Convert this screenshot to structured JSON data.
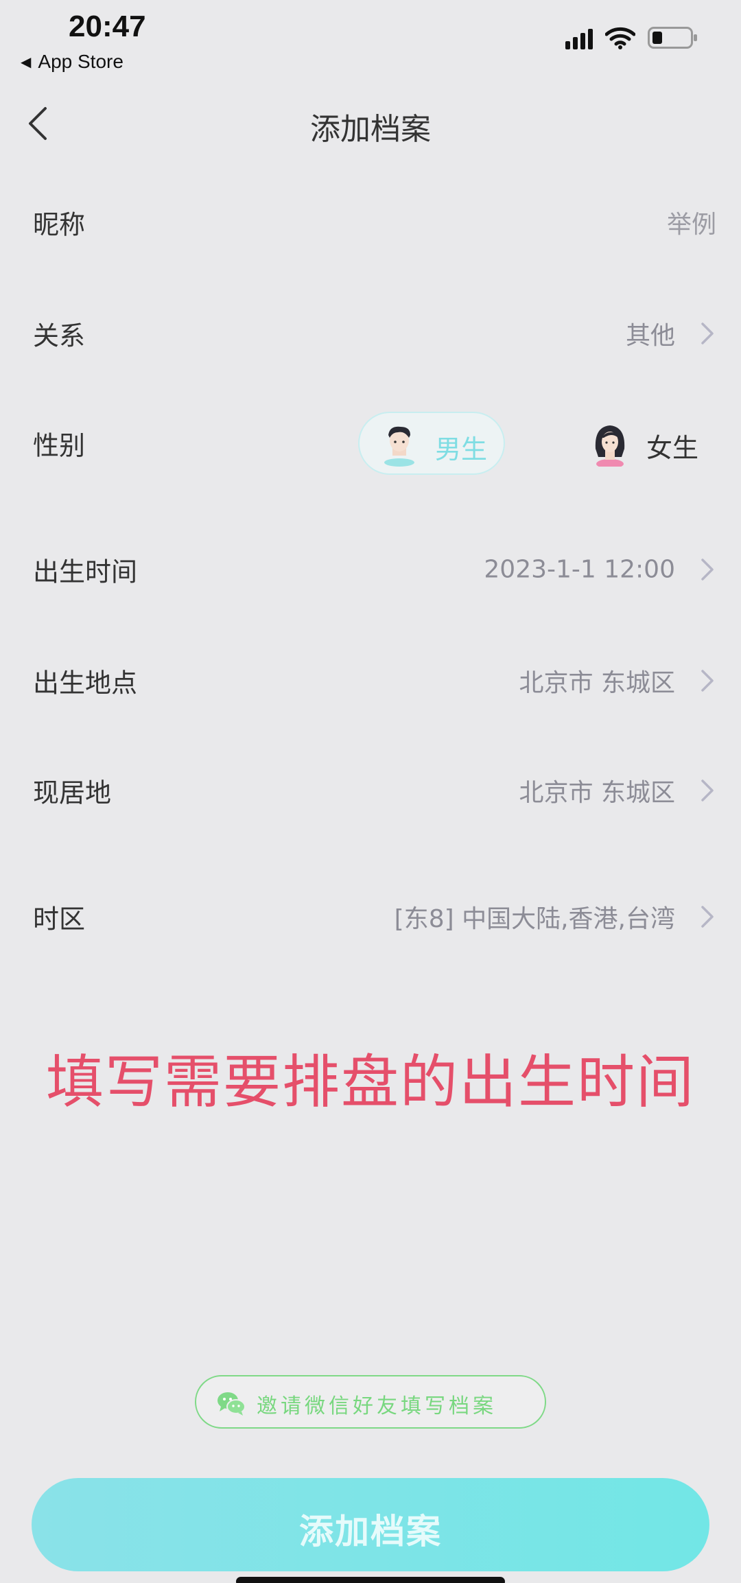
{
  "status_bar": {
    "time": "20:47",
    "back_app": "App Store",
    "icons": [
      "signal-icon",
      "wifi-icon",
      "battery-icon"
    ]
  },
  "nav": {
    "title": "添加档案",
    "back_icon": "chevron-left-icon"
  },
  "form": {
    "nickname": {
      "label": "昵称",
      "placeholder": "举例"
    },
    "relation": {
      "label": "关系",
      "value": "其他"
    },
    "gender": {
      "label": "性别",
      "male": "男生",
      "female": "女生",
      "selected": "male"
    },
    "birth_time": {
      "label": "出生时间",
      "value": "2023-1-1 12:00"
    },
    "birth_place": {
      "label": "出生地点",
      "value": "北京市 东城区"
    },
    "residence": {
      "label": "现居地",
      "value": "北京市 东城区"
    },
    "timezone": {
      "label": "时区",
      "value": "[东8] 中国大陆,香港,台湾"
    }
  },
  "annotation": "填写需要排盘的出生时间",
  "invite_button": "邀请微信好友填写档案",
  "submit_button": "添加档案",
  "colors": {
    "accent": "#72e6e6",
    "annotation": "#e54f6a",
    "wechat_green": "#78d77f",
    "background": "#e9e9eb"
  }
}
